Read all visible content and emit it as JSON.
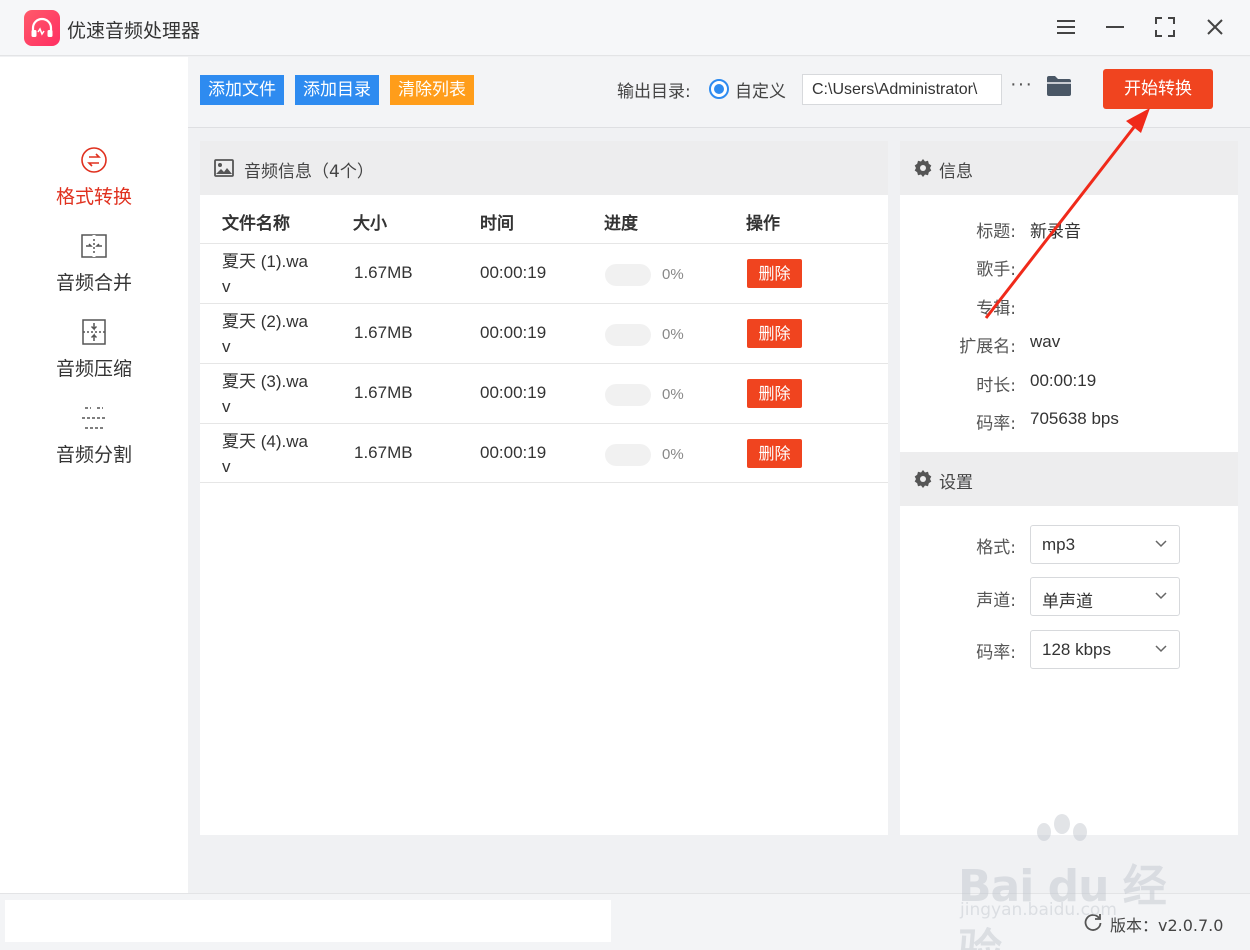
{
  "app": {
    "title": "优速音频处理器"
  },
  "window_controls": {
    "icons": [
      "menu-icon",
      "minimize-icon",
      "maximize-icon",
      "close-icon"
    ]
  },
  "sidebar": {
    "items": [
      {
        "label": "格式转换",
        "icon": "format-convert-icon",
        "active": true
      },
      {
        "label": "音频合并",
        "icon": "merge-icon",
        "active": false
      },
      {
        "label": "音频压缩",
        "icon": "compress-icon",
        "active": false
      },
      {
        "label": "音频分割",
        "icon": "split-icon",
        "active": false
      }
    ]
  },
  "toolbar": {
    "add_file": "添加文件",
    "add_dir": "添加目录",
    "clear_list": "清除列表",
    "output_label": "输出目录:",
    "radio_label": "自定义",
    "output_path": "C:\\Users\\Administrator\\",
    "more": "···",
    "start": "开始转换"
  },
  "file_list": {
    "title": "音频信息（4个）",
    "columns": [
      "文件名称",
      "大小",
      "时间",
      "进度",
      "操作"
    ],
    "rows": [
      {
        "name": "夏天 (1).wav",
        "size": "1.67MB",
        "duration": "00:00:19",
        "progress": 0,
        "progress_text": "0%",
        "action": "删除"
      },
      {
        "name": "夏天 (2).wav",
        "size": "1.67MB",
        "duration": "00:00:19",
        "progress": 0,
        "progress_text": "0%",
        "action": "删除"
      },
      {
        "name": "夏天 (3).wav",
        "size": "1.67MB",
        "duration": "00:00:19",
        "progress": 0,
        "progress_text": "0%",
        "action": "删除"
      },
      {
        "name": "夏天 (4).wav",
        "size": "1.67MB",
        "duration": "00:00:19",
        "progress": 0,
        "progress_text": "0%",
        "action": "删除"
      }
    ]
  },
  "info": {
    "title": "信息",
    "fields": [
      {
        "key": "标题:",
        "value": "新录音"
      },
      {
        "key": "歌手:",
        "value": ""
      },
      {
        "key": "专辑:",
        "value": ""
      },
      {
        "key": "扩展名:",
        "value": "wav"
      },
      {
        "key": "时长:",
        "value": "00:00:19"
      },
      {
        "key": "码率:",
        "value": "705638 bps"
      }
    ]
  },
  "settings": {
    "title": "设置",
    "fields": [
      {
        "key": "格式:",
        "value": "mp3"
      },
      {
        "key": "声道:",
        "value": "单声道"
      },
      {
        "key": "码率:",
        "value": "128 kbps"
      }
    ]
  },
  "footer": {
    "version": "版本：v2.0.7.0"
  },
  "watermark": {
    "brand": "Bai du 经验",
    "url": "jingyan.baidu.com"
  },
  "colors": {
    "accent_red": "#f0441f",
    "blue": "#2e8bf0",
    "orange": "#ff9d1a",
    "active_nav": "#e0311f"
  }
}
